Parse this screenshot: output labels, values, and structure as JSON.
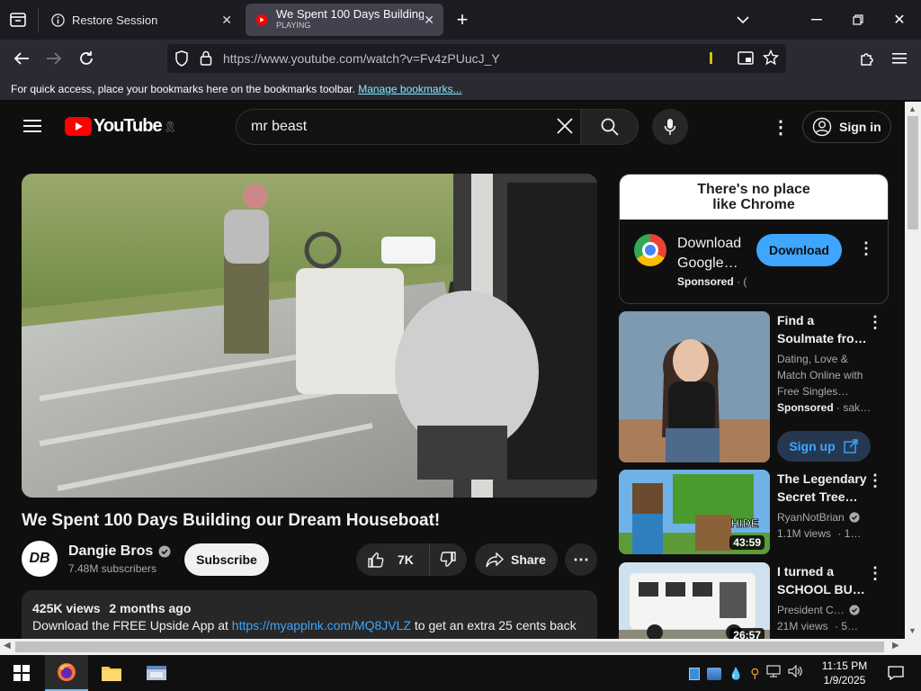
{
  "browser": {
    "tabs": [
      {
        "title": "Restore Session",
        "subtitle": ""
      },
      {
        "title": "We Spent 100 Days Building ou",
        "subtitle": "PLAYING"
      }
    ],
    "url": "https://www.youtube.com/watch?v=Fv4zPUucJ_Y",
    "bookmarks_text": "For quick access, place your bookmarks here on the bookmarks toolbar.",
    "bookmarks_link": "Manage bookmarks..."
  },
  "youtube": {
    "logo_text": "YouTube",
    "search_value": "mr beast",
    "signin_label": "Sign in",
    "video": {
      "title": "We Spent 100 Days Building our Dream Houseboat!",
      "channel": "Dangie Bros",
      "channel_avatar_text": "DB",
      "subscribers": "7.48M subscribers",
      "subscribe_label": "Subscribe",
      "likes": "7K",
      "share_label": "Share",
      "views": "425K views",
      "age": "2 months ago",
      "desc_prefix": "Download the FREE Upside App at",
      "desc_link": "https://myapplnk.com/MQ8JVLZ",
      "desc_suffix": "to get an extra 25 cents back"
    },
    "ad": {
      "banner_line1": "There's no place",
      "banner_line2": "like Chrome",
      "title": "Download Google…",
      "sponsored": "Sponsored",
      "sponsored_extra": "· (",
      "button": "Download"
    },
    "recs": [
      {
        "title1": "Find a",
        "title2": "Soulmate fro…",
        "desc": [
          "Dating, Love &",
          "Match Online with",
          "Free Singles…"
        ],
        "meta1": "Sponsored",
        "meta2": "· sak…",
        "button": "Sign up",
        "duration": ""
      },
      {
        "title1": "The Legendary",
        "title2": "Secret Tree…",
        "channel": "RyanNotBrian",
        "views": "1.1M views",
        "extra": "· 1…",
        "duration": "43:59",
        "thumb_text": "HIDE"
      },
      {
        "title1": "I turned a",
        "title2": "SCHOOL BUS…",
        "channel": "President C…",
        "views": "21M views",
        "extra": "· 5…",
        "duration": "26:57"
      }
    ]
  },
  "taskbar": {
    "time": "11:15 PM",
    "date": "1/9/2025"
  },
  "colors": {
    "yt_red": "#ff0000",
    "download_blue": "#3ea6ff",
    "signup_bg": "#263850",
    "tab_active": "#42414d"
  }
}
